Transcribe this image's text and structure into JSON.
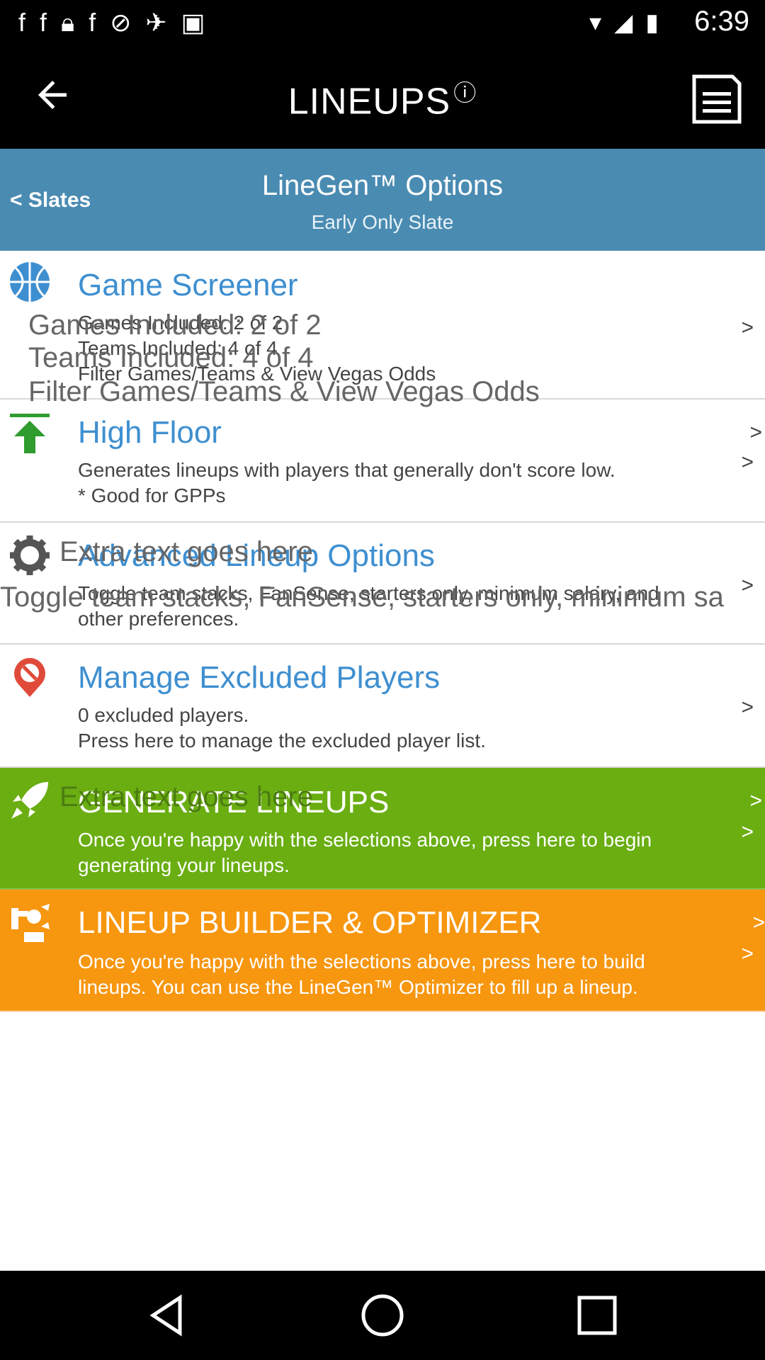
{
  "status_bar": {
    "time": "6:39"
  },
  "app_bar": {
    "title": "LINEUPS",
    "info_glyph": "ⓘ"
  },
  "header": {
    "back_label": "< Slates",
    "title": "LineGen™ Options",
    "subtitle": "Early Only Slate"
  },
  "rows": [
    {
      "title": "Game Screener",
      "desc": "Games Included: 2 of 2\nTeams Included: 4 of 4\nFilter Games/Teams & View Vegas Odds",
      "ghost": [
        "Games Included: 2 of 2",
        "Teams Included: 4 of 4",
        "Filter Games/Teams & View Vegas Odds"
      ],
      "chev": ">"
    },
    {
      "title": "High Floor",
      "desc": "Generates lineups with players that generally don't score low.\n* Good for GPPs",
      "chev": ">",
      "chev_top": ">"
    },
    {
      "title": "Advanced Lineup Options",
      "desc": "Toggle team stacks, FanSense, starters only, minimum salary, and\nother preferences.",
      "ghost": [
        "Extra text goes here",
        "Toggle team stacks, FanSense, starters only, minimum sa"
      ],
      "chev": ">"
    },
    {
      "title": "Manage Excluded Players",
      "desc": "0 excluded players.\nPress here to manage the excluded player list.",
      "chev": ">"
    },
    {
      "title": "GENERATE LINEUPS",
      "desc": "Once you're happy with the selections above, press here to begin\ngenerating your lineups.",
      "ghost": [
        "Extra text goes here"
      ],
      "chev": ">",
      "chev_top": ">"
    },
    {
      "title": "LINEUP BUILDER & OPTIMIZER",
      "desc": "Once you're happy with the selections above, press here to build\nlineups. You can use the LineGen™ Optimizer to fill up a lineup.",
      "chev": ">",
      "chev_top": ">"
    }
  ],
  "colors": {
    "header": "#4a8bb2",
    "title_blue": "#3e8fd0",
    "generate": "#6aae12",
    "builder": "#f7960f"
  }
}
